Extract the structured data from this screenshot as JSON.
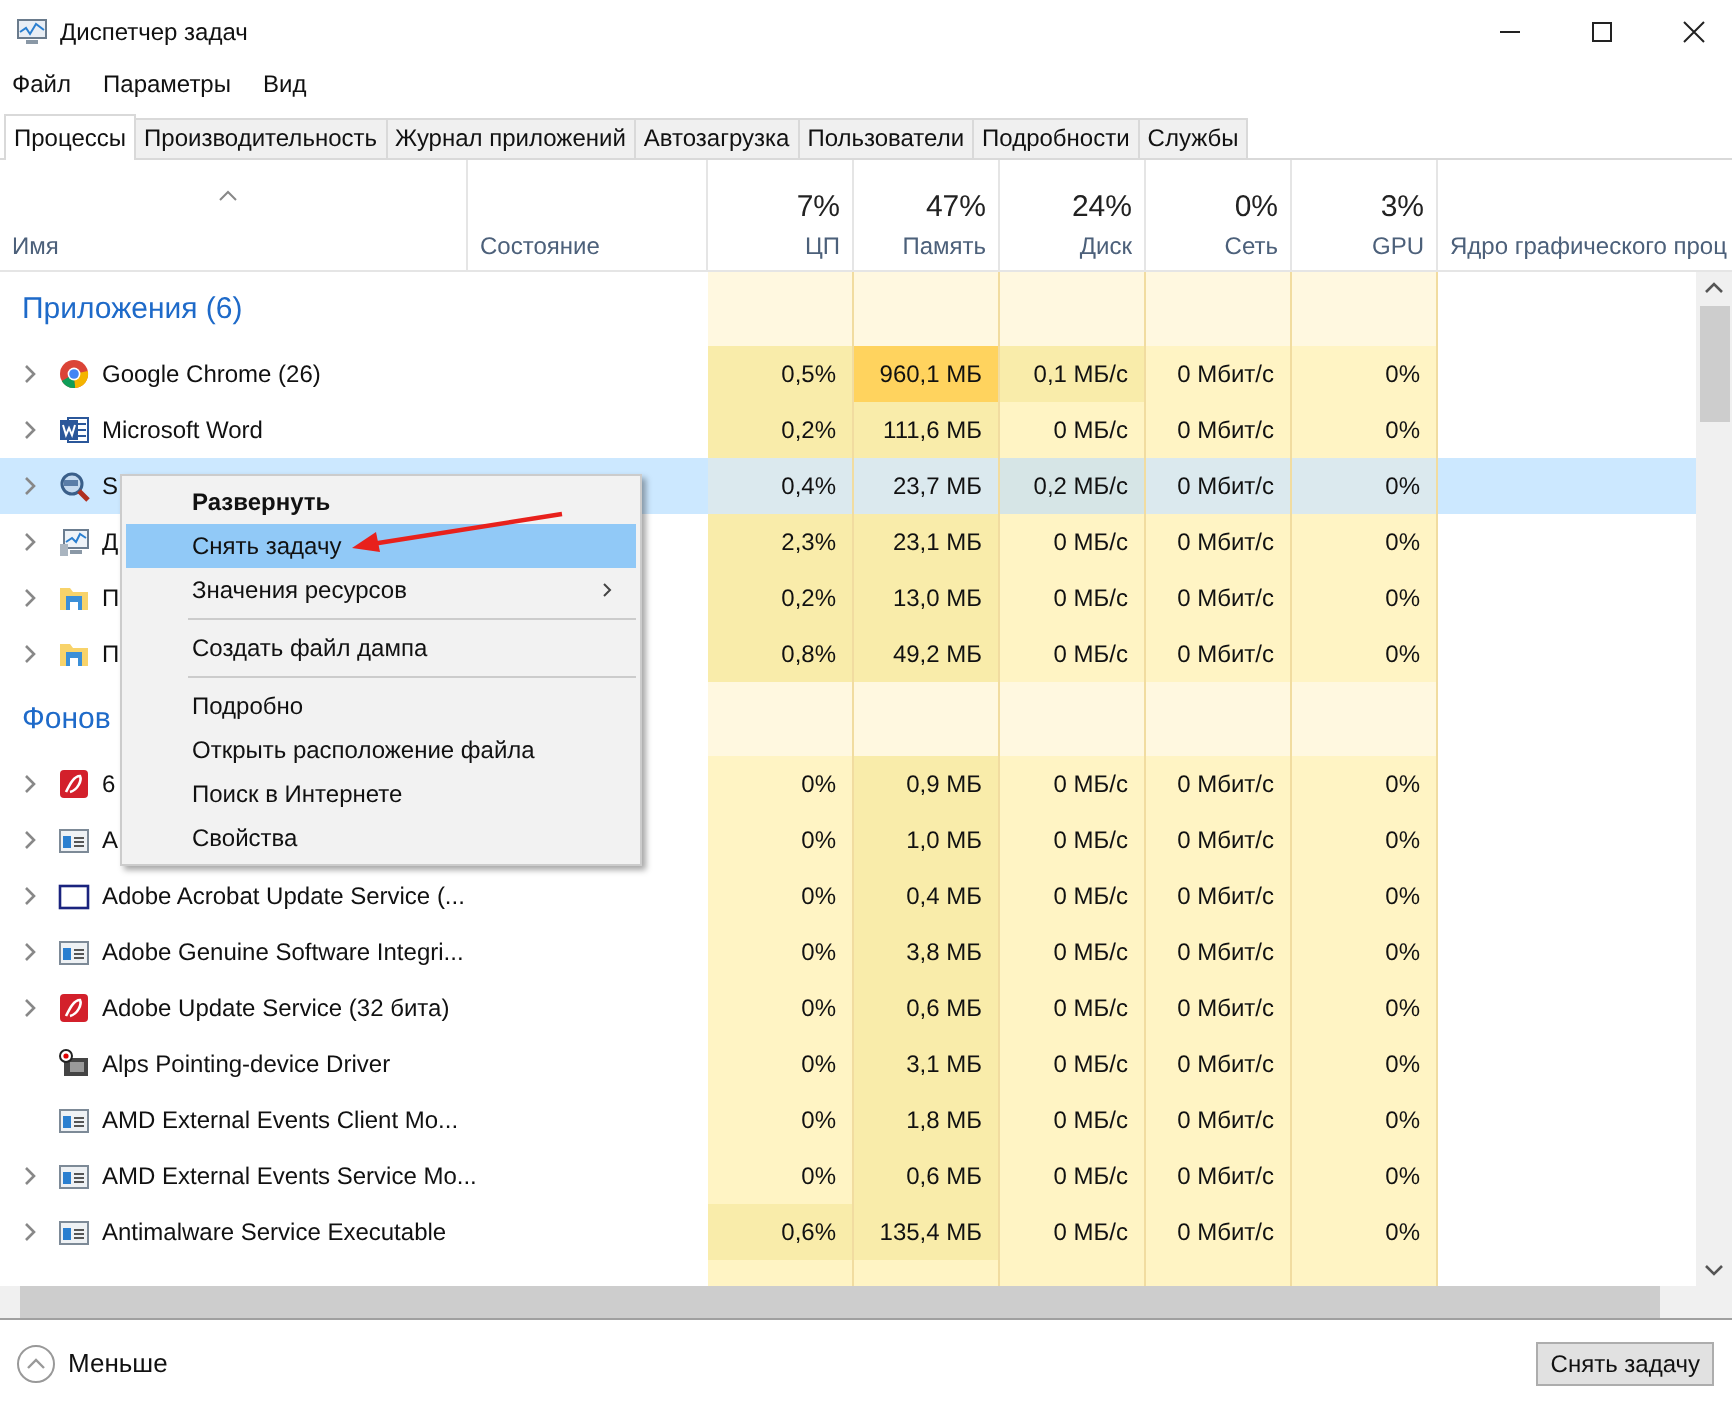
{
  "window": {
    "title": "Диспетчер задач"
  },
  "menu": [
    "Файл",
    "Параметры",
    "Вид"
  ],
  "tabs": [
    {
      "label": "Процессы",
      "selected": true
    },
    {
      "label": "Производительность",
      "selected": false
    },
    {
      "label": "Журнал приложений",
      "selected": false
    },
    {
      "label": "Автозагрузка",
      "selected": false
    },
    {
      "label": "Пользователи",
      "selected": false
    },
    {
      "label": "Подробности",
      "selected": false
    },
    {
      "label": "Службы",
      "selected": false
    }
  ],
  "columns": [
    {
      "label": "Имя"
    },
    {
      "label": "Состояние"
    },
    {
      "total": "7%",
      "label": "ЦП"
    },
    {
      "total": "47%",
      "label": "Память"
    },
    {
      "total": "24%",
      "label": "Диск"
    },
    {
      "total": "0%",
      "label": "Сеть"
    },
    {
      "total": "3%",
      "label": "GPU"
    },
    {
      "label": "Ядро графического проц"
    }
  ],
  "groups": [
    {
      "title": "Приложения (6)",
      "rows": [
        {
          "name": "Google Chrome (26)",
          "kind": "chrome",
          "expandable": true,
          "selected": false,
          "cells": [
            {
              "text": "0,5%",
              "color": "#f9ecaa"
            },
            {
              "text": "960,1 МБ",
              "color": "#ffd35e"
            },
            {
              "text": "0,1 МБ/с",
              "color": "#f9ecaa"
            },
            {
              "text": "0 Мбит/с",
              "color": "#fff4c4"
            },
            {
              "text": "0%",
              "color": "#fff4c4"
            }
          ]
        },
        {
          "name": "Microsoft Word",
          "kind": "word",
          "expandable": true,
          "selected": false,
          "cells": [
            {
              "text": "0,2%",
              "color": "#f9ecaa"
            },
            {
              "text": "111,6 МБ",
              "color": "#f9ecaa"
            },
            {
              "text": "0 МБ/с",
              "color": "#fff4c4"
            },
            {
              "text": "0 Мбит/с",
              "color": "#fff4c4"
            },
            {
              "text": "0%",
              "color": "#fff4c4"
            }
          ]
        },
        {
          "name": "S",
          "kind": "magnifier",
          "expandable": true,
          "selected": true,
          "cells": [
            {
              "text": "0,4%",
              "color": "#dbe9ee"
            },
            {
              "text": "23,7 МБ",
              "color": "#dbe9ee"
            },
            {
              "text": "0,2 МБ/с",
              "color": "#d6e5e6"
            },
            {
              "text": "0 Мбит/с",
              "color": "#dbe9ee"
            },
            {
              "text": "0%",
              "color": "#dbe9ee"
            }
          ]
        },
        {
          "name": "Д",
          "kind": "monitor",
          "expandable": true,
          "selected": false,
          "cells": [
            {
              "text": "2,3%",
              "color": "#f9ecaa"
            },
            {
              "text": "23,1 МБ",
              "color": "#f9ecaa"
            },
            {
              "text": "0 МБ/с",
              "color": "#fff4c4"
            },
            {
              "text": "0 Мбит/с",
              "color": "#fff4c4"
            },
            {
              "text": "0%",
              "color": "#fff4c4"
            }
          ]
        },
        {
          "name": "П",
          "kind": "folder",
          "expandable": true,
          "selected": false,
          "cells": [
            {
              "text": "0,2%",
              "color": "#f9ecaa"
            },
            {
              "text": "13,0 МБ",
              "color": "#f9ecaa"
            },
            {
              "text": "0 МБ/с",
              "color": "#fff4c4"
            },
            {
              "text": "0 Мбит/с",
              "color": "#fff4c4"
            },
            {
              "text": "0%",
              "color": "#fff4c4"
            }
          ]
        },
        {
          "name": "П",
          "kind": "folder",
          "expandable": true,
          "selected": false,
          "cells": [
            {
              "text": "0,8%",
              "color": "#f9ecaa"
            },
            {
              "text": "49,2 МБ",
              "color": "#f9ecaa"
            },
            {
              "text": "0 МБ/с",
              "color": "#fff4c4"
            },
            {
              "text": "0 Мбит/с",
              "color": "#fff4c4"
            },
            {
              "text": "0%",
              "color": "#fff4c4"
            }
          ]
        }
      ]
    },
    {
      "title": "Фонов",
      "rows": [
        {
          "name": "6",
          "kind": "redapp",
          "expandable": true,
          "selected": false,
          "cells": [
            {
              "text": "0%",
              "color": "#fff4c4"
            },
            {
              "text": "0,9 МБ",
              "color": "#f9ecaa"
            },
            {
              "text": "0 МБ/с",
              "color": "#fff4c4"
            },
            {
              "text": "0 Мбит/с",
              "color": "#fff4c4"
            },
            {
              "text": "0%",
              "color": "#fff4c4"
            }
          ]
        },
        {
          "name": "A",
          "kind": "window",
          "expandable": true,
          "selected": false,
          "cells": [
            {
              "text": "0%",
              "color": "#fff4c4"
            },
            {
              "text": "1,0 МБ",
              "color": "#f9ecaa"
            },
            {
              "text": "0 МБ/с",
              "color": "#fff4c4"
            },
            {
              "text": "0 Мбит/с",
              "color": "#fff4c4"
            },
            {
              "text": "0%",
              "color": "#fff4c4"
            }
          ]
        },
        {
          "name": "Adobe Acrobat Update Service (...",
          "kind": "frame",
          "expandable": true,
          "selected": false,
          "cells": [
            {
              "text": "0%",
              "color": "#fff4c4"
            },
            {
              "text": "0,4 МБ",
              "color": "#f9ecaa"
            },
            {
              "text": "0 МБ/с",
              "color": "#fff4c4"
            },
            {
              "text": "0 Мбит/с",
              "color": "#fff4c4"
            },
            {
              "text": "0%",
              "color": "#fff4c4"
            }
          ]
        },
        {
          "name": "Adobe Genuine Software Integri...",
          "kind": "window",
          "expandable": true,
          "selected": false,
          "cells": [
            {
              "text": "0%",
              "color": "#fff4c4"
            },
            {
              "text": "3,8 МБ",
              "color": "#f9ecaa"
            },
            {
              "text": "0 МБ/с",
              "color": "#fff4c4"
            },
            {
              "text": "0 Мбит/с",
              "color": "#fff4c4"
            },
            {
              "text": "0%",
              "color": "#fff4c4"
            }
          ]
        },
        {
          "name": "Adobe Update Service (32 бита)",
          "kind": "redapp",
          "expandable": true,
          "selected": false,
          "cells": [
            {
              "text": "0%",
              "color": "#fff4c4"
            },
            {
              "text": "0,6 МБ",
              "color": "#f9ecaa"
            },
            {
              "text": "0 МБ/с",
              "color": "#fff4c4"
            },
            {
              "text": "0 Мбит/с",
              "color": "#fff4c4"
            },
            {
              "text": "0%",
              "color": "#fff4c4"
            }
          ]
        },
        {
          "name": "Alps Pointing-device Driver",
          "kind": "device",
          "expandable": false,
          "selected": false,
          "cells": [
            {
              "text": "0%",
              "color": "#fff4c4"
            },
            {
              "text": "3,1 МБ",
              "color": "#f9ecaa"
            },
            {
              "text": "0 МБ/с",
              "color": "#fff4c4"
            },
            {
              "text": "0 Мбит/с",
              "color": "#fff4c4"
            },
            {
              "text": "0%",
              "color": "#fff4c4"
            }
          ]
        },
        {
          "name": "AMD External Events Client Mo...",
          "kind": "window",
          "expandable": false,
          "selected": false,
          "cells": [
            {
              "text": "0%",
              "color": "#fff4c4"
            },
            {
              "text": "1,8 МБ",
              "color": "#f9ecaa"
            },
            {
              "text": "0 МБ/с",
              "color": "#fff4c4"
            },
            {
              "text": "0 Мбит/с",
              "color": "#fff4c4"
            },
            {
              "text": "0%",
              "color": "#fff4c4"
            }
          ]
        },
        {
          "name": "AMD External Events Service Mo...",
          "kind": "window",
          "expandable": true,
          "selected": false,
          "cells": [
            {
              "text": "0%",
              "color": "#fff4c4"
            },
            {
              "text": "0,6 МБ",
              "color": "#f9ecaa"
            },
            {
              "text": "0 МБ/с",
              "color": "#fff4c4"
            },
            {
              "text": "0 Мбит/с",
              "color": "#fff4c4"
            },
            {
              "text": "0%",
              "color": "#fff4c4"
            }
          ]
        },
        {
          "name": "Antimalware Service Executable",
          "kind": "window",
          "expandable": true,
          "selected": false,
          "cells": [
            {
              "text": "0,6%",
              "color": "#f9ecaa"
            },
            {
              "text": "135,4 МБ",
              "color": "#f9ecaa"
            },
            {
              "text": "0 МБ/с",
              "color": "#fff4c4"
            },
            {
              "text": "0 Мбит/с",
              "color": "#fff4c4"
            },
            {
              "text": "0%",
              "color": "#fff4c4"
            }
          ]
        }
      ]
    }
  ],
  "context_menu": {
    "items": [
      {
        "kind": "item",
        "label": "Развернуть",
        "bold": true,
        "selected": false,
        "submenu": false
      },
      {
        "kind": "item",
        "label": "Снять задачу",
        "bold": false,
        "selected": true,
        "submenu": false
      },
      {
        "kind": "item",
        "label": "Значения ресурсов",
        "bold": false,
        "selected": false,
        "submenu": true
      },
      {
        "kind": "separator"
      },
      {
        "kind": "item",
        "label": "Создать файл дампа",
        "bold": false,
        "selected": false,
        "submenu": false
      },
      {
        "kind": "separator"
      },
      {
        "kind": "item",
        "label": "Подробно",
        "bold": false,
        "selected": false,
        "submenu": false
      },
      {
        "kind": "item",
        "label": "Открыть расположение файла",
        "bold": false,
        "selected": false,
        "submenu": false
      },
      {
        "kind": "item",
        "label": "Поиск в Интернете",
        "bold": false,
        "selected": false,
        "submenu": false
      },
      {
        "kind": "item",
        "label": "Свойства",
        "bold": false,
        "selected": false,
        "submenu": false
      }
    ]
  },
  "footer": {
    "toggle": "Меньше",
    "button": "Снять задачу"
  }
}
